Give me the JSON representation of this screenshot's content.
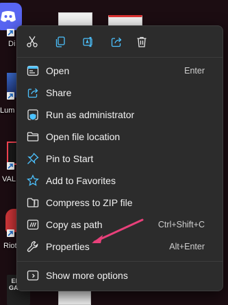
{
  "colors": {
    "menu_bg": "#2c2c2c",
    "accent_blue": "#4cc2ff",
    "annotation_arrow": "#e8407a"
  },
  "desktop": {
    "icons": [
      {
        "label": "Di",
        "icon": "discord-icon"
      },
      {
        "label": "Lum",
        "icon": "lumion-icon"
      },
      {
        "label": "VAL",
        "icon": "valorant-icon"
      },
      {
        "label": "Riot",
        "icon": "riot-client-icon"
      },
      {
        "label": "EPIC GAMES",
        "icon": "epic-games-icon"
      }
    ]
  },
  "quick_actions": [
    {
      "name": "cut",
      "icon": "scissors-icon"
    },
    {
      "name": "copy",
      "icon": "copy-icon"
    },
    {
      "name": "rename",
      "icon": "rename-icon"
    },
    {
      "name": "share",
      "icon": "share-icon"
    },
    {
      "name": "delete",
      "icon": "trash-icon"
    }
  ],
  "menu": {
    "items": [
      {
        "label": "Open",
        "shortcut": "Enter",
        "icon": "open-icon"
      },
      {
        "label": "Share",
        "shortcut": "",
        "icon": "share-icon"
      },
      {
        "label": "Run as administrator",
        "shortcut": "",
        "icon": "shield-icon"
      },
      {
        "label": "Open file location",
        "shortcut": "",
        "icon": "folder-icon"
      },
      {
        "label": "Pin to Start",
        "shortcut": "",
        "icon": "pin-icon"
      },
      {
        "label": "Add to Favorites",
        "shortcut": "",
        "icon": "star-icon"
      },
      {
        "label": "Compress to ZIP file",
        "shortcut": "",
        "icon": "zip-folder-icon"
      },
      {
        "label": "Copy as path",
        "shortcut": "Ctrl+Shift+C",
        "icon": "copy-path-icon"
      },
      {
        "label": "Properties",
        "shortcut": "Alt+Enter",
        "icon": "wrench-icon"
      }
    ],
    "more": {
      "label": "Show more options",
      "icon": "more-options-icon"
    }
  }
}
